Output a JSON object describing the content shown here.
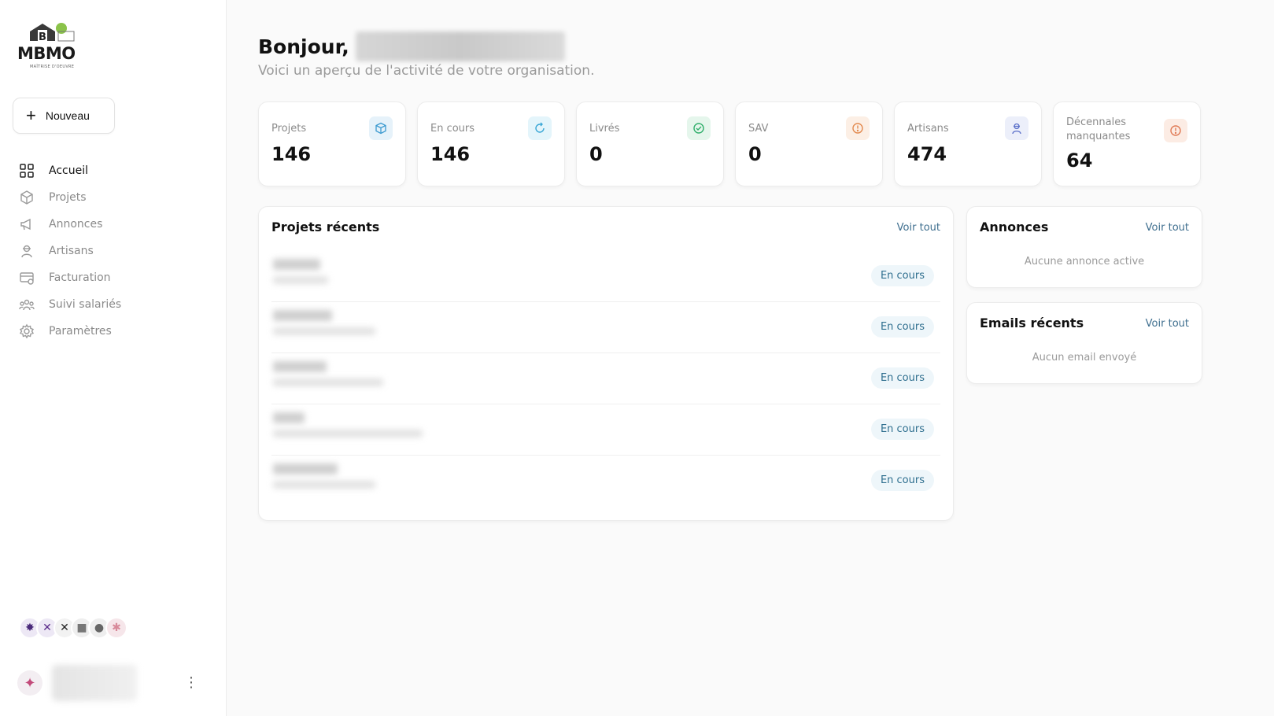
{
  "logo": {
    "text": "MBMO",
    "subtext": "MAÎTRISE D'OEUVRE"
  },
  "sidebar": {
    "new_button": "Nouveau",
    "items": [
      {
        "label": "Accueil",
        "icon": "grid-icon",
        "active": true
      },
      {
        "label": "Projets",
        "icon": "cube-icon",
        "active": false
      },
      {
        "label": "Annonces",
        "icon": "megaphone-icon",
        "active": false
      },
      {
        "label": "Artisans",
        "icon": "worker-icon",
        "active": false
      },
      {
        "label": "Facturation",
        "icon": "invoice-icon",
        "active": false
      },
      {
        "label": "Suivi salariés",
        "icon": "team-icon",
        "active": false
      },
      {
        "label": "Paramètres",
        "icon": "gear-icon",
        "active": false
      }
    ]
  },
  "header": {
    "greeting": "Bonjour,",
    "subtitle": "Voici un aperçu de l'activité de votre organisation."
  },
  "stats": [
    {
      "label": "Projets",
      "value": "146",
      "icon": "cube-icon",
      "color": "#3c9ad0",
      "bg": "#e6f2fa"
    },
    {
      "label": "En cours",
      "value": "146",
      "icon": "refresh-icon",
      "color": "#3aa7d6",
      "bg": "#e4f5fb"
    },
    {
      "label": "Livrés",
      "value": "0",
      "icon": "check-circle-icon",
      "color": "#2fae6a",
      "bg": "#e5f6ec"
    },
    {
      "label": "SAV",
      "value": "0",
      "icon": "alert-circle-icon",
      "color": "#e38a4f",
      "bg": "#fcefe5"
    },
    {
      "label": "Artisans",
      "value": "474",
      "icon": "worker-icon",
      "color": "#5b6fc9",
      "bg": "#eceffa"
    },
    {
      "label": "Décennales manquantes",
      "value": "64",
      "icon": "alert-circle-icon",
      "color": "#e07a55",
      "bg": "#fcece4"
    }
  ],
  "recent_projects": {
    "title": "Projets récents",
    "link": "Voir tout",
    "rows": [
      {
        "status": "En cours"
      },
      {
        "status": "En cours"
      },
      {
        "status": "En cours"
      },
      {
        "status": "En cours"
      },
      {
        "status": "En cours"
      }
    ]
  },
  "announcements": {
    "title": "Annonces",
    "link": "Voir tout",
    "empty": "Aucune annonce active"
  },
  "emails": {
    "title": "Emails récents",
    "link": "Voir tout",
    "empty": "Aucun email envoyé"
  }
}
